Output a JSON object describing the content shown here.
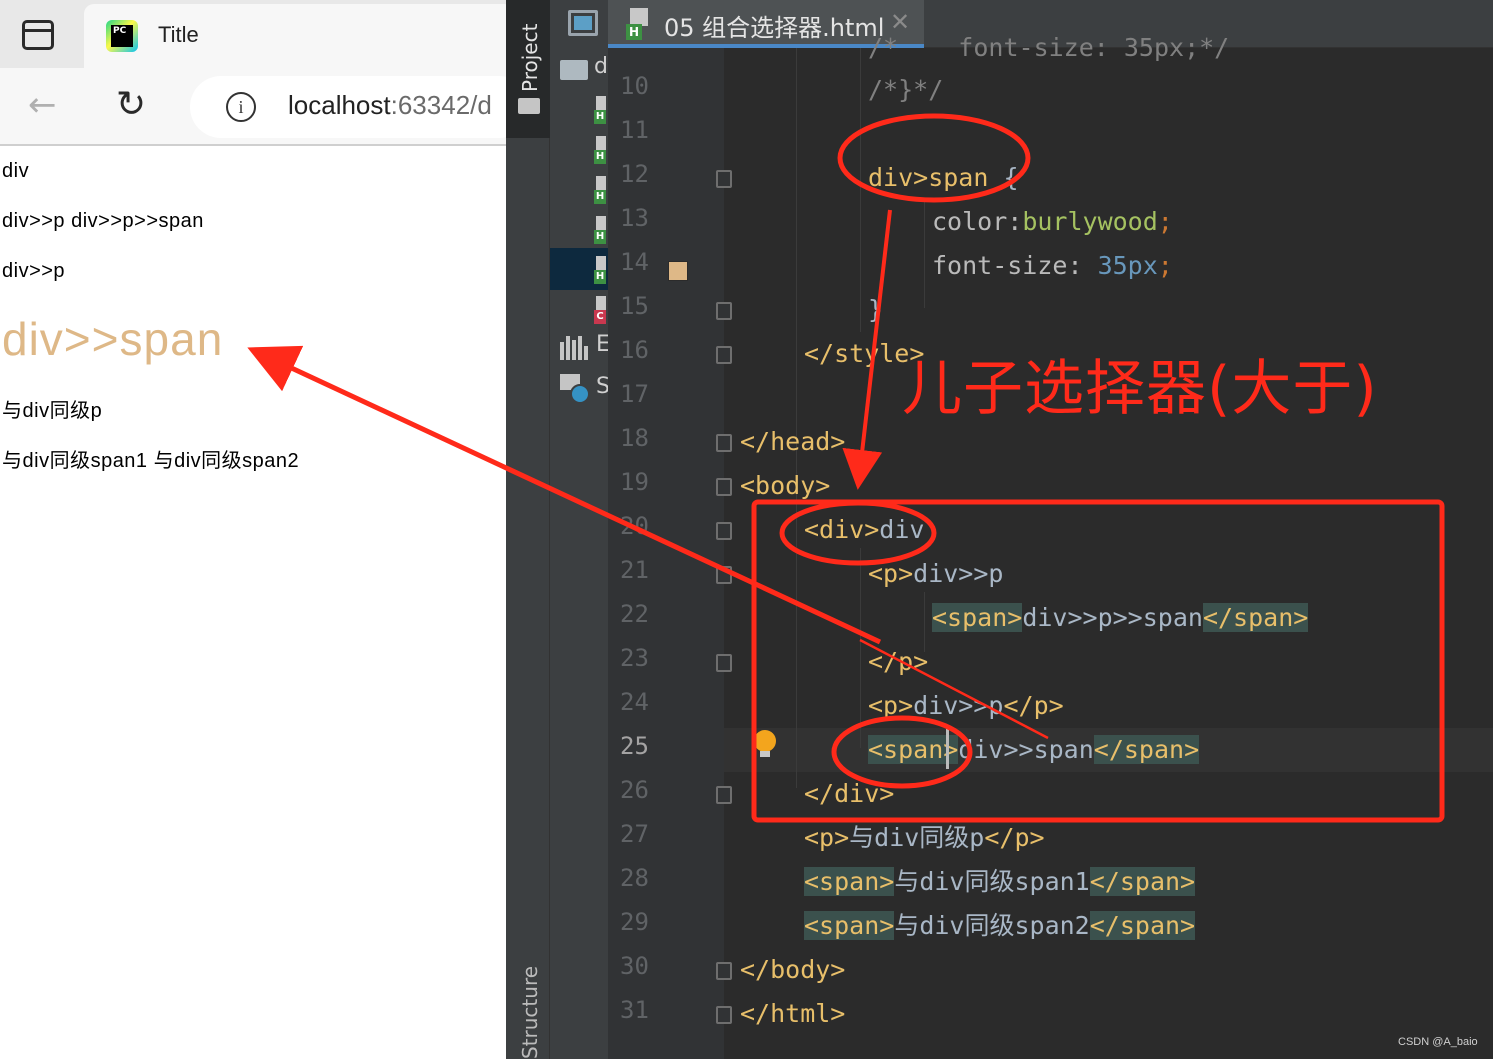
{
  "browser": {
    "tab_title": "Title",
    "url_host": "localhost",
    "url_rest": ":63342/d",
    "favicon_text": "PC",
    "icons": {
      "sidebar_toggle": "sidebar-toggle-icon",
      "back": "back-arrow-icon",
      "reload": "reload-icon",
      "info": "info-icon"
    },
    "back_glyph": "←",
    "reload_glyph": "↻",
    "info_glyph": "i",
    "page_lines": [
      "div",
      "div>>p div>>p>>span",
      "div>>p",
      "div>>span",
      "与div同级p",
      "与div同级span1 与div同级span2"
    ],
    "highlight_color": "#deb887"
  },
  "ide": {
    "tool_window_project": "Project",
    "tool_window_structure": "Structure",
    "project_root_label": "d",
    "project_ext_label": "E",
    "project_scratch_label": "S",
    "file_badge_html": "H",
    "file_badge_css": "C",
    "editor_tab_label": "05 组合选择器.html",
    "editor_tab_close": "✕",
    "current_line": 25,
    "line_numbers": [
      "10",
      "11",
      "12",
      "13",
      "14",
      "15",
      "16",
      "17",
      "18",
      "19",
      "20",
      "21",
      "22",
      "23",
      "24",
      "25",
      "26",
      "27",
      "28",
      "29",
      "30",
      "31"
    ],
    "swatch_color": "#deb887",
    "code": {
      "l9": "/*    font-size: 35px;*/",
      "l10": "/*}*/",
      "l12_sel": "div>span",
      "l12_brace": " {",
      "l13_prop": "color:",
      "l13_val": "burlywood",
      "l13_semi": ";",
      "l14_prop": "font-size: ",
      "l14_num": "35px",
      "l14_semi": ";",
      "l15": "}",
      "l16": "</style>",
      "l18": "</head>",
      "l19": "<body>",
      "l20_tag": "<div>",
      "l20_text": "div",
      "l21_tag": "<p>",
      "l21_text": "div>>p",
      "l22_open": "<span>",
      "l22_text": "div>>p>>span",
      "l22_close": "</span>",
      "l23": "</p>",
      "l24_open": "<p>",
      "l24_text": "div>>p",
      "l24_close": "</p>",
      "l25_open": "<span>",
      "l25_text": "div>>span",
      "l25_close": "</span>",
      "l26": "</div>",
      "l27_open": "<p>",
      "l27_text": "与div同级p",
      "l27_close": "</p>",
      "l28_open": "<span>",
      "l28_text": "与div同级span1",
      "l28_close": "</span>",
      "l29_open": "<span>",
      "l29_text": "与div同级span2",
      "l29_close": "</span>",
      "l30": "</body>",
      "l31": "</html>"
    }
  },
  "annotation": {
    "text": "儿子选择器(大于)",
    "color": "#ff2a1a"
  },
  "watermark": "CSDN @A_baio"
}
